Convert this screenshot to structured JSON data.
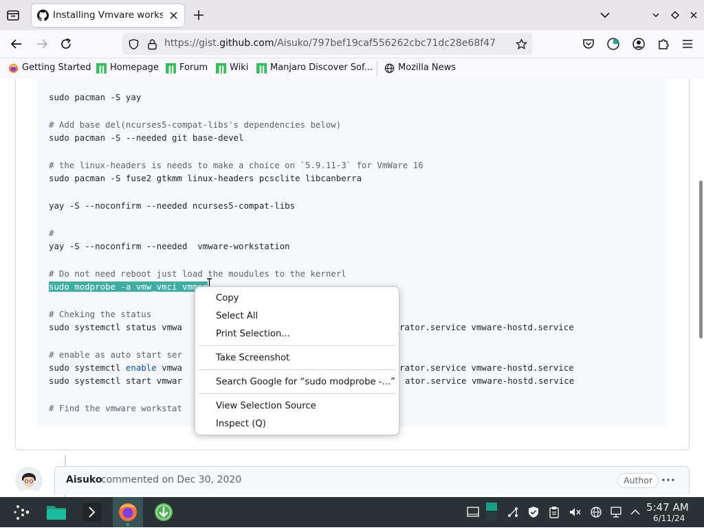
{
  "tab": {
    "title": "Installing Vmvare workstation",
    "favicon": "github-icon"
  },
  "url": {
    "prefix": "https://gist.",
    "host": "github.com",
    "path": "/Aisuko/797bef19caf556262cbc71dc28e68f47"
  },
  "bookmarks": [
    {
      "label": "Getting Started",
      "icon": "firefox-icon"
    },
    {
      "label": "Homepage",
      "icon": "manjaro-icon"
    },
    {
      "label": "Forum",
      "icon": "manjaro-icon"
    },
    {
      "label": "Wiki",
      "icon": "manjaro-icon"
    },
    {
      "label": "Manjaro Discover Sof...",
      "icon": "manjaro-icon"
    },
    {
      "label": "Mozilla News",
      "icon": "globe-icon"
    }
  ],
  "code": {
    "l1": "sudo pacman -S yay",
    "l2": "# Add base del(ncurses5-compat-libs's dependencies below)",
    "l3": "sudo pacman -S --needed git base-devel",
    "l4": "# the linux-headers is needs to make a choice on `5.9.11-3` for VmWare 16",
    "l5": "sudo pacman -S fuse2 gtkmm linux-headers pcsclite libcanberra",
    "l6": "yay -S --noconfirm --needed ncurses5-compat-libs",
    "l7": "#",
    "l8": "yay -S --noconfirm --needed  vmware-workstation",
    "l9": "# Do not need reboot just load the moudules to the kernerl",
    "l10": "sudo modprobe -a vmw_vmci vmmon",
    "l11": "# Cheking the status",
    "l12a": "sudo systemctl status vmwa",
    "l12b": "rator.service vmware-hostd.service",
    "l13": "# enable as auto start ser",
    "l14a": "sudo systemctl ",
    "l14kw": "enable",
    "l14b": " vmwa",
    "l14c": "rator.service vmware-hostd.service",
    "l15a": "sudo systemctl start vmwar",
    "l15b": "ator.service vmware-hostd.service",
    "l16": "# Find the vmware workstat"
  },
  "context_menu": {
    "copy": "Copy",
    "select_all": "Select All",
    "print_selection": "Print Selection...",
    "take_screenshot": "Take Screenshot",
    "search_google": "Search Google for “sudo modprobe -...”",
    "view_source": "View Selection Source",
    "inspect": "Inspect (Q)"
  },
  "comment": {
    "author": "Aisuko",
    "meta": "commented on Dec 30, 2020",
    "badge": "Author"
  },
  "clock": {
    "time": "5:47 AM",
    "date": "6/11/24"
  },
  "colors": {
    "selection": "#3daea3",
    "taskbar": "#2b3236",
    "accent": "#1abc9c"
  }
}
